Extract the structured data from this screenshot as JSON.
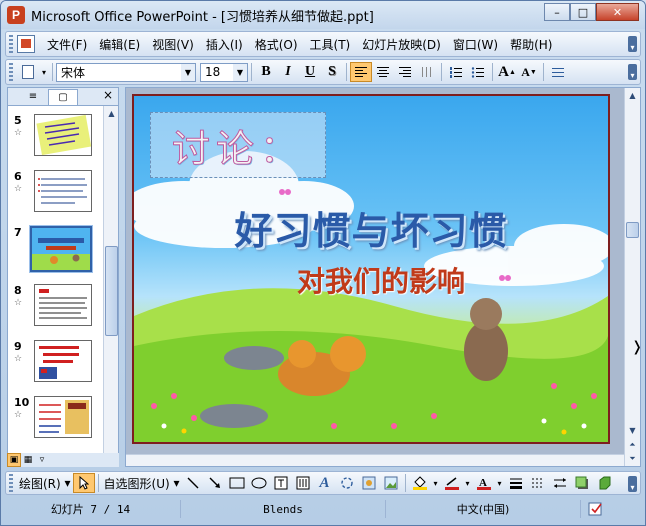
{
  "window": {
    "title": "Microsoft Office PowerPoint - [习惯培养从细节做起.ppt]",
    "app_icon_glyph": "P",
    "minimize": "–",
    "maximize": "□",
    "close": "✕"
  },
  "menu": {
    "items": [
      "文件(F)",
      "编辑(E)",
      "视图(V)",
      "插入(I)",
      "格式(O)",
      "工具(T)",
      "幻灯片放映(D)",
      "窗口(W)",
      "帮助(H)"
    ]
  },
  "format_toolbar": {
    "font_name": "宋体",
    "font_size": "18",
    "bold": "B",
    "italic": "I",
    "underline": "U",
    "shadow": "S",
    "grow_font": "A",
    "shrink_font": "A"
  },
  "left_pane": {
    "tab_outline": "≡",
    "tab_slides": "▢",
    "close": "×",
    "slides": [
      {
        "number": "5",
        "star": "☆"
      },
      {
        "number": "6",
        "star": "☆"
      },
      {
        "number": "7",
        "star": "",
        "selected": true
      },
      {
        "number": "8",
        "star": "☆"
      },
      {
        "number": "9",
        "star": "☆"
      },
      {
        "number": "10",
        "star": "☆"
      }
    ]
  },
  "slide": {
    "discussion_label": "讨论：",
    "title": "好习惯与坏习惯",
    "subtitle": "对我们的影响"
  },
  "draw_toolbar": {
    "draw_menu": "绘图(R)",
    "autoshapes_menu": "自选图形(U)"
  },
  "status": {
    "slide_indicator": "幻灯片 7 / 14",
    "design_template": "Blends",
    "language": "中文(中国)"
  },
  "colors": {
    "accent": "#ffc870",
    "title_text": "#2a5aa8",
    "subtitle_text": "#c03a1a"
  }
}
